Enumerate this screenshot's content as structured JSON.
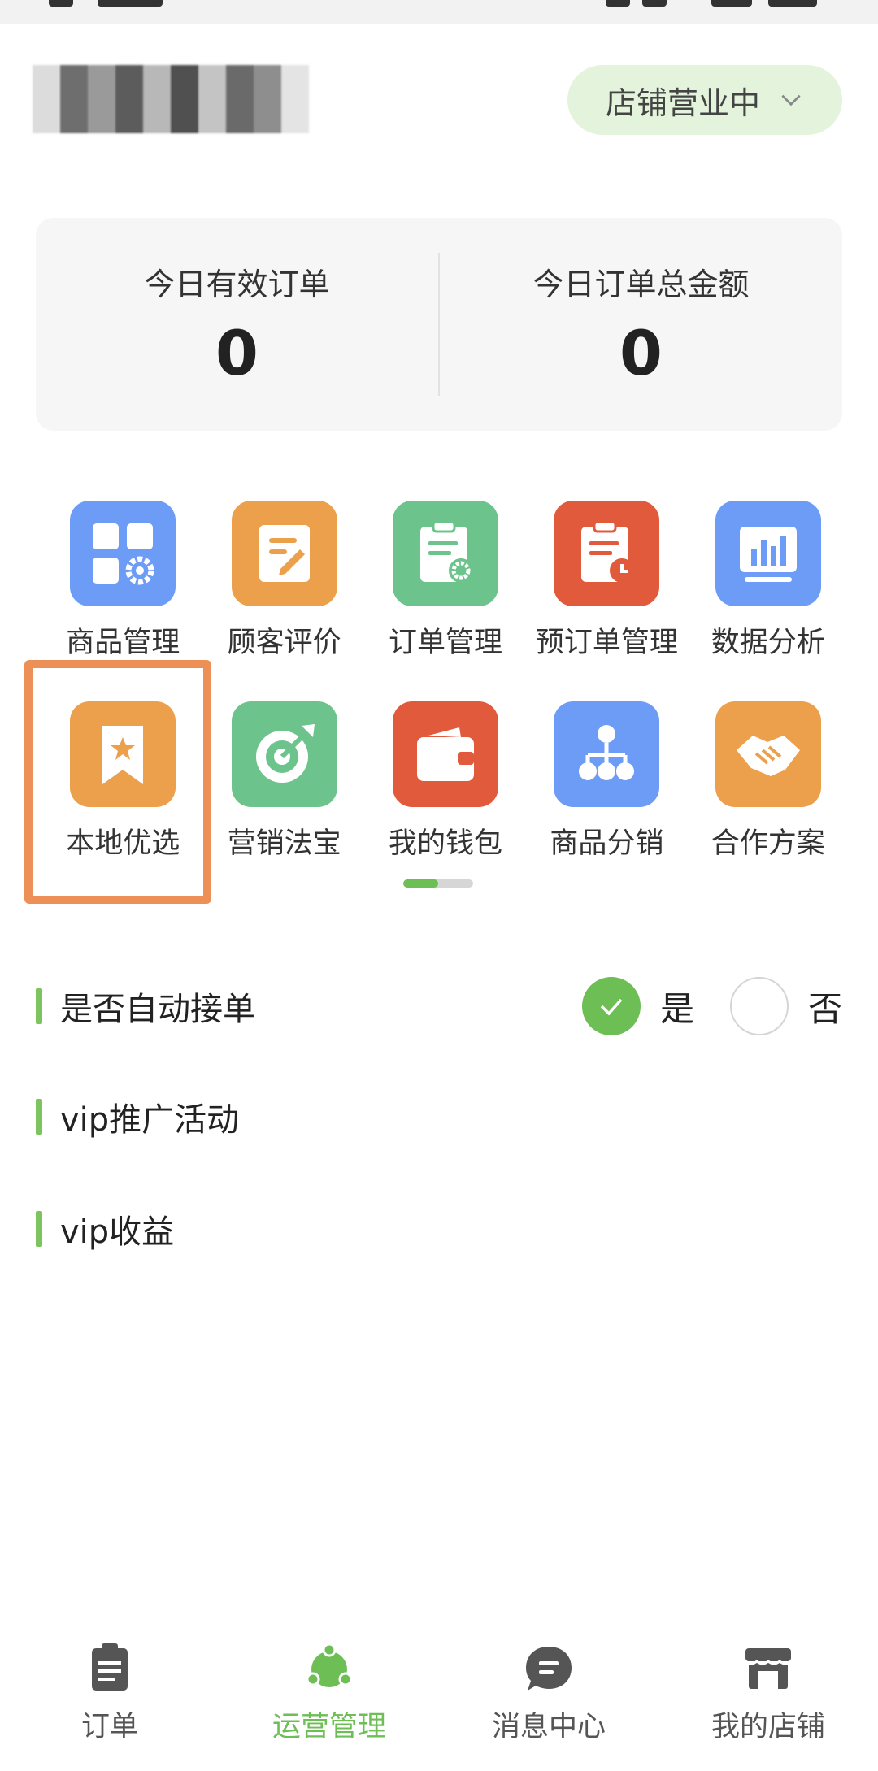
{
  "header": {
    "shop_name_masked": true,
    "status_pill": {
      "label": "店铺营业中"
    }
  },
  "stats": {
    "valid_orders": {
      "label": "今日有效订单",
      "value": "0"
    },
    "total_amount": {
      "label": "今日订单总金额",
      "value": "0"
    }
  },
  "menu": [
    {
      "label": "商品管理",
      "icon": "grid-gear-icon",
      "color": "#6d9cf7"
    },
    {
      "label": "顾客评价",
      "icon": "note-pen-icon",
      "color": "#eca04b"
    },
    {
      "label": "订单管理",
      "icon": "clipboard-gear-icon",
      "color": "#6cc48c"
    },
    {
      "label": "预订单管理",
      "icon": "clipboard-clock-icon",
      "color": "#e25a3c"
    },
    {
      "label": "数据分析",
      "icon": "bar-chart-icon",
      "color": "#6d9cf7"
    },
    {
      "label": "本地优选",
      "icon": "bookmark-star-icon",
      "color": "#eca04b"
    },
    {
      "label": "营销法宝",
      "icon": "target-arrow-icon",
      "color": "#6cc48c"
    },
    {
      "label": "我的钱包",
      "icon": "wallet-icon",
      "color": "#e25a3c"
    },
    {
      "label": "商品分销",
      "icon": "org-tree-icon",
      "color": "#6d9cf7"
    },
    {
      "label": "合作方案",
      "icon": "handshake-icon",
      "color": "#eca04b"
    }
  ],
  "pager": {
    "pages": 2,
    "current": 1
  },
  "settings": {
    "auto_accept": {
      "label": "是否自动接单",
      "yes": "是",
      "no": "否",
      "selected": "是"
    },
    "vip_promo": {
      "label": "vip推广活动"
    },
    "vip_income": {
      "label": "vip收益"
    }
  },
  "tabs": [
    {
      "label": "订单",
      "icon": "clipboard-list-icon",
      "active": false
    },
    {
      "label": "运营管理",
      "icon": "operations-icon",
      "active": true
    },
    {
      "label": "消息中心",
      "icon": "chat-bubble-icon",
      "active": false
    },
    {
      "label": "我的店铺",
      "icon": "storefront-icon",
      "active": false
    }
  ],
  "colors": {
    "accent": "#6dbe55",
    "highlight": "#ec9057",
    "pill_bg": "#e4f3dc"
  }
}
